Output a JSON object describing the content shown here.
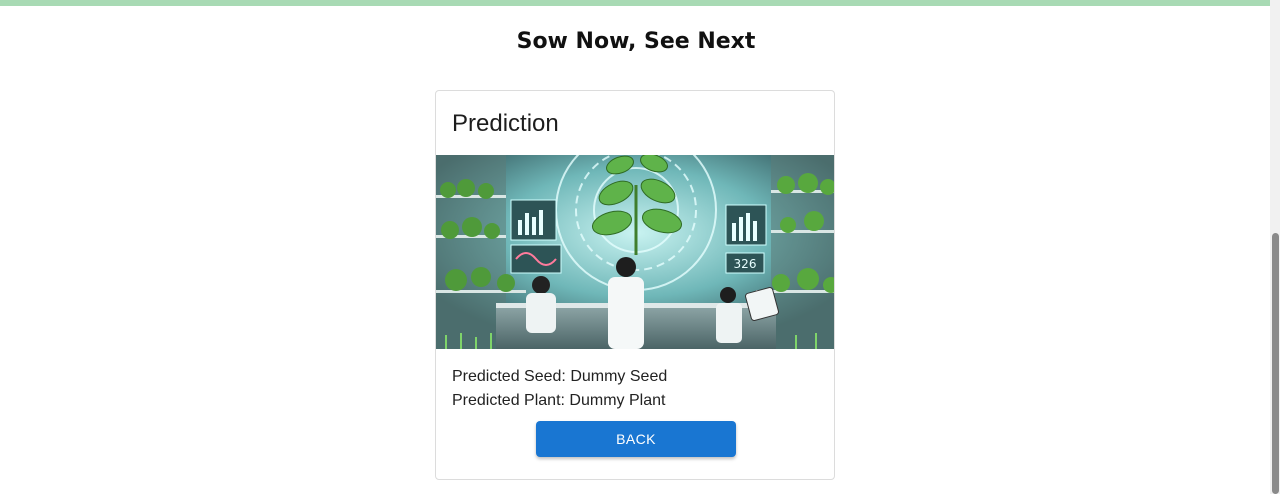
{
  "header": {
    "title": "Sow Now, See Next"
  },
  "card": {
    "title": "Prediction",
    "image_display_value": "326",
    "seed_label": "Predicted Seed:",
    "seed_value": "Dummy Seed",
    "plant_label": "Predicted Plant:",
    "plant_value": "Dummy Plant",
    "back_label": "BACK"
  },
  "colors": {
    "top_bar": "#a8dab4",
    "button": "#1976d2",
    "card_border": "#dcdcdc"
  }
}
